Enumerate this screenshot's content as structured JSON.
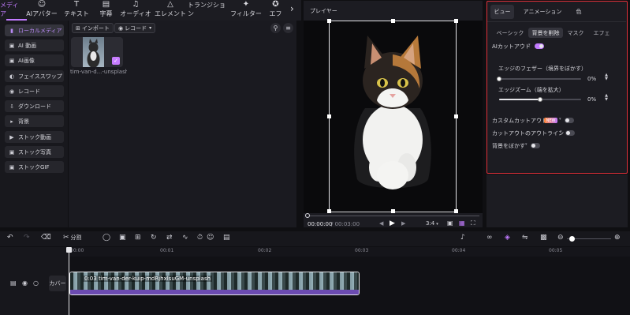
{
  "toolbar": {
    "items": [
      {
        "label": "メディア",
        "icon": "media-icon",
        "active": true
      },
      {
        "label": "AIアバター",
        "icon": "avatar-icon"
      },
      {
        "label": "テキスト",
        "icon": "text-icon"
      },
      {
        "label": "字幕",
        "icon": "captions-icon"
      },
      {
        "label": "オーディオ",
        "icon": "audio-icon"
      },
      {
        "label": "エレメント",
        "icon": "element-icon"
      },
      {
        "label": "トランジション",
        "icon": "transition-icon"
      },
      {
        "label": "フィルター",
        "icon": "filter-icon"
      },
      {
        "label": "エフ",
        "icon": "effect-icon"
      }
    ],
    "accent": "#c27bff"
  },
  "sidebar": {
    "items": [
      {
        "label": "ローカルメディア",
        "icon": "folder-icon",
        "active": true
      },
      {
        "label": "AI 動画",
        "icon": "ai-video-icon"
      },
      {
        "label": "AI画像",
        "icon": "ai-image-icon"
      },
      {
        "label": "フェイススワップ",
        "icon": "face-swap-icon"
      },
      {
        "label": "レコード",
        "icon": "record-icon"
      },
      {
        "label": "ダウンロード",
        "icon": "download-icon"
      },
      {
        "label": "背景",
        "icon": "background-icon"
      },
      {
        "label": "ストック動画",
        "icon": "stock-video-icon"
      },
      {
        "label": "ストック写真",
        "icon": "stock-photo-icon"
      },
      {
        "label": "ストックGIF",
        "icon": "stock-gif-icon"
      }
    ]
  },
  "media": {
    "import_label": "インポート",
    "record_label": "レコード",
    "thumb_caption": "tim-van-d...-unsplash"
  },
  "player": {
    "title": "プレイヤー",
    "time_current": "00:00:00",
    "time_total": "/ 00:03:00",
    "aspect": "3:4"
  },
  "inspector": {
    "tabs": [
      "ビュー",
      "アニメーション",
      "色"
    ],
    "subtabs": [
      "ベーシック",
      "背景を削除",
      "マスク",
      "エフェ"
    ],
    "ai_cutout_label": "AIカットアウト",
    "ai_cutout_on": true,
    "feather_label": "エッジのフェザー（境界をぼかす）",
    "feather_value": "0%",
    "feather_level": 0,
    "zoom_label": "エッジズーム（端を拡大）",
    "zoom_value": "0%",
    "zoom_level": 0.5,
    "custom_cutout_label": "カスタムカットアウト",
    "new_badge": "NEW",
    "custom_cutout_on": false,
    "outline_label": "カットアウトのアウトライン",
    "outline_on": false,
    "blur_bg_label": "背景をぼかす",
    "blur_bg_on": false,
    "border_color": "#e0303a"
  },
  "timeline": {
    "split_label": "分割",
    "cover_label": "カバー",
    "ruler": [
      "00:00",
      "00:01",
      "00:02",
      "00:03",
      "00:04",
      "00:05"
    ],
    "clip_label": "0:03 tim-van-der-kuip-mdRjhxlsuGM-unsplash",
    "clip_audio_color": "#6b4bb0"
  }
}
